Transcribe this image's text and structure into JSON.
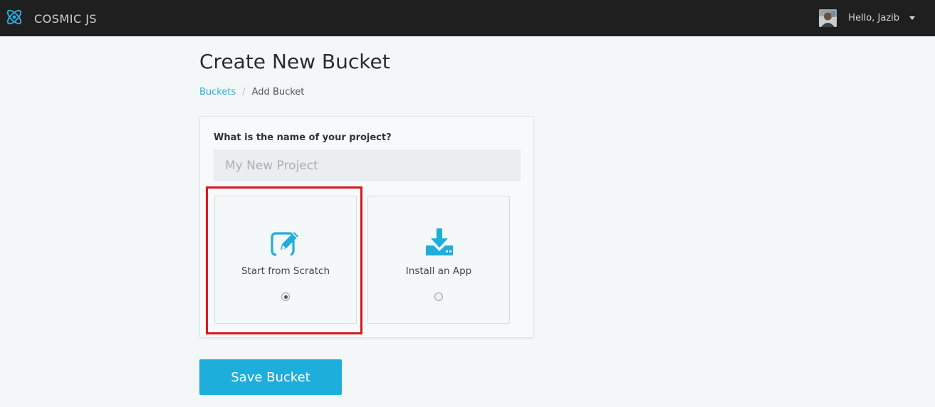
{
  "navbar": {
    "brand": "COSMIC JS",
    "brand_icon": "atom-logo-icon",
    "user_greeting": "Hello, Jazib",
    "avatar": "user-avatar",
    "dropdown_icon": "caret-down-icon"
  },
  "page": {
    "title": "Create New Bucket"
  },
  "breadcrumb": {
    "parent": "Buckets",
    "separator": "/",
    "current": "Add Bucket"
  },
  "form": {
    "project_label": "What is the name of your project?",
    "project_placeholder": "My New Project",
    "project_value": "",
    "options": [
      {
        "label": "Start from Scratch",
        "icon": "edit-icon",
        "selected": true
      },
      {
        "label": "Install an App",
        "icon": "download-icon",
        "selected": false
      }
    ],
    "highlighted_option": "Start from Scratch",
    "save_label": "Save Bucket"
  },
  "colors": {
    "navbar_bg": "#1f1f1f",
    "accent": "#1eaedb",
    "link": "#29abe2",
    "highlight": "#d9161c",
    "page_bg": "#f4f7f8"
  }
}
